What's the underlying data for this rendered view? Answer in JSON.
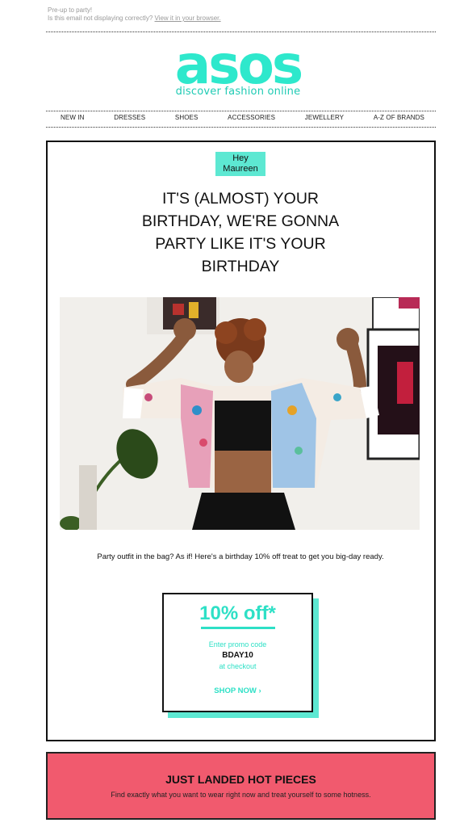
{
  "preheader": {
    "line1": "Pre-up to party!",
    "line2_prefix": "Is this email not displaying correctly?",
    "line2_link": "View it in your browser."
  },
  "logo": {
    "word": "asos",
    "tagline": "discover fashion online"
  },
  "nav": {
    "items": [
      "NEW IN",
      "DRESSES",
      "SHOES",
      "ACCESSORIES",
      "JEWELLERY",
      "A-Z OF BRANDS"
    ]
  },
  "greeting": {
    "line1": "Hey",
    "line2": "Maureen"
  },
  "headline": {
    "line1": "IT'S (ALMOST) YOUR",
    "line2": "BIRTHDAY, WE'RE GONNA",
    "line3": "PARTY LIKE IT'S YOUR",
    "line4": "BIRTHDAY"
  },
  "body_copy": "Party outfit in the bag? As if! Here's a birthday 10% off treat to get you big-day ready.",
  "promo": {
    "discount": "10% off*",
    "enter": "Enter promo code",
    "code": "BDAY10",
    "at": "at checkout",
    "cta": "SHOP NOW ›"
  },
  "banner": {
    "title": "JUST LANDED HOT PIECES",
    "subtitle": "Find exactly what you want to wear right now and treat yourself to some hotness."
  },
  "colors": {
    "accent": "#2ee0c6",
    "accent_light": "#5de8d2",
    "banner": "#f15a6e"
  }
}
